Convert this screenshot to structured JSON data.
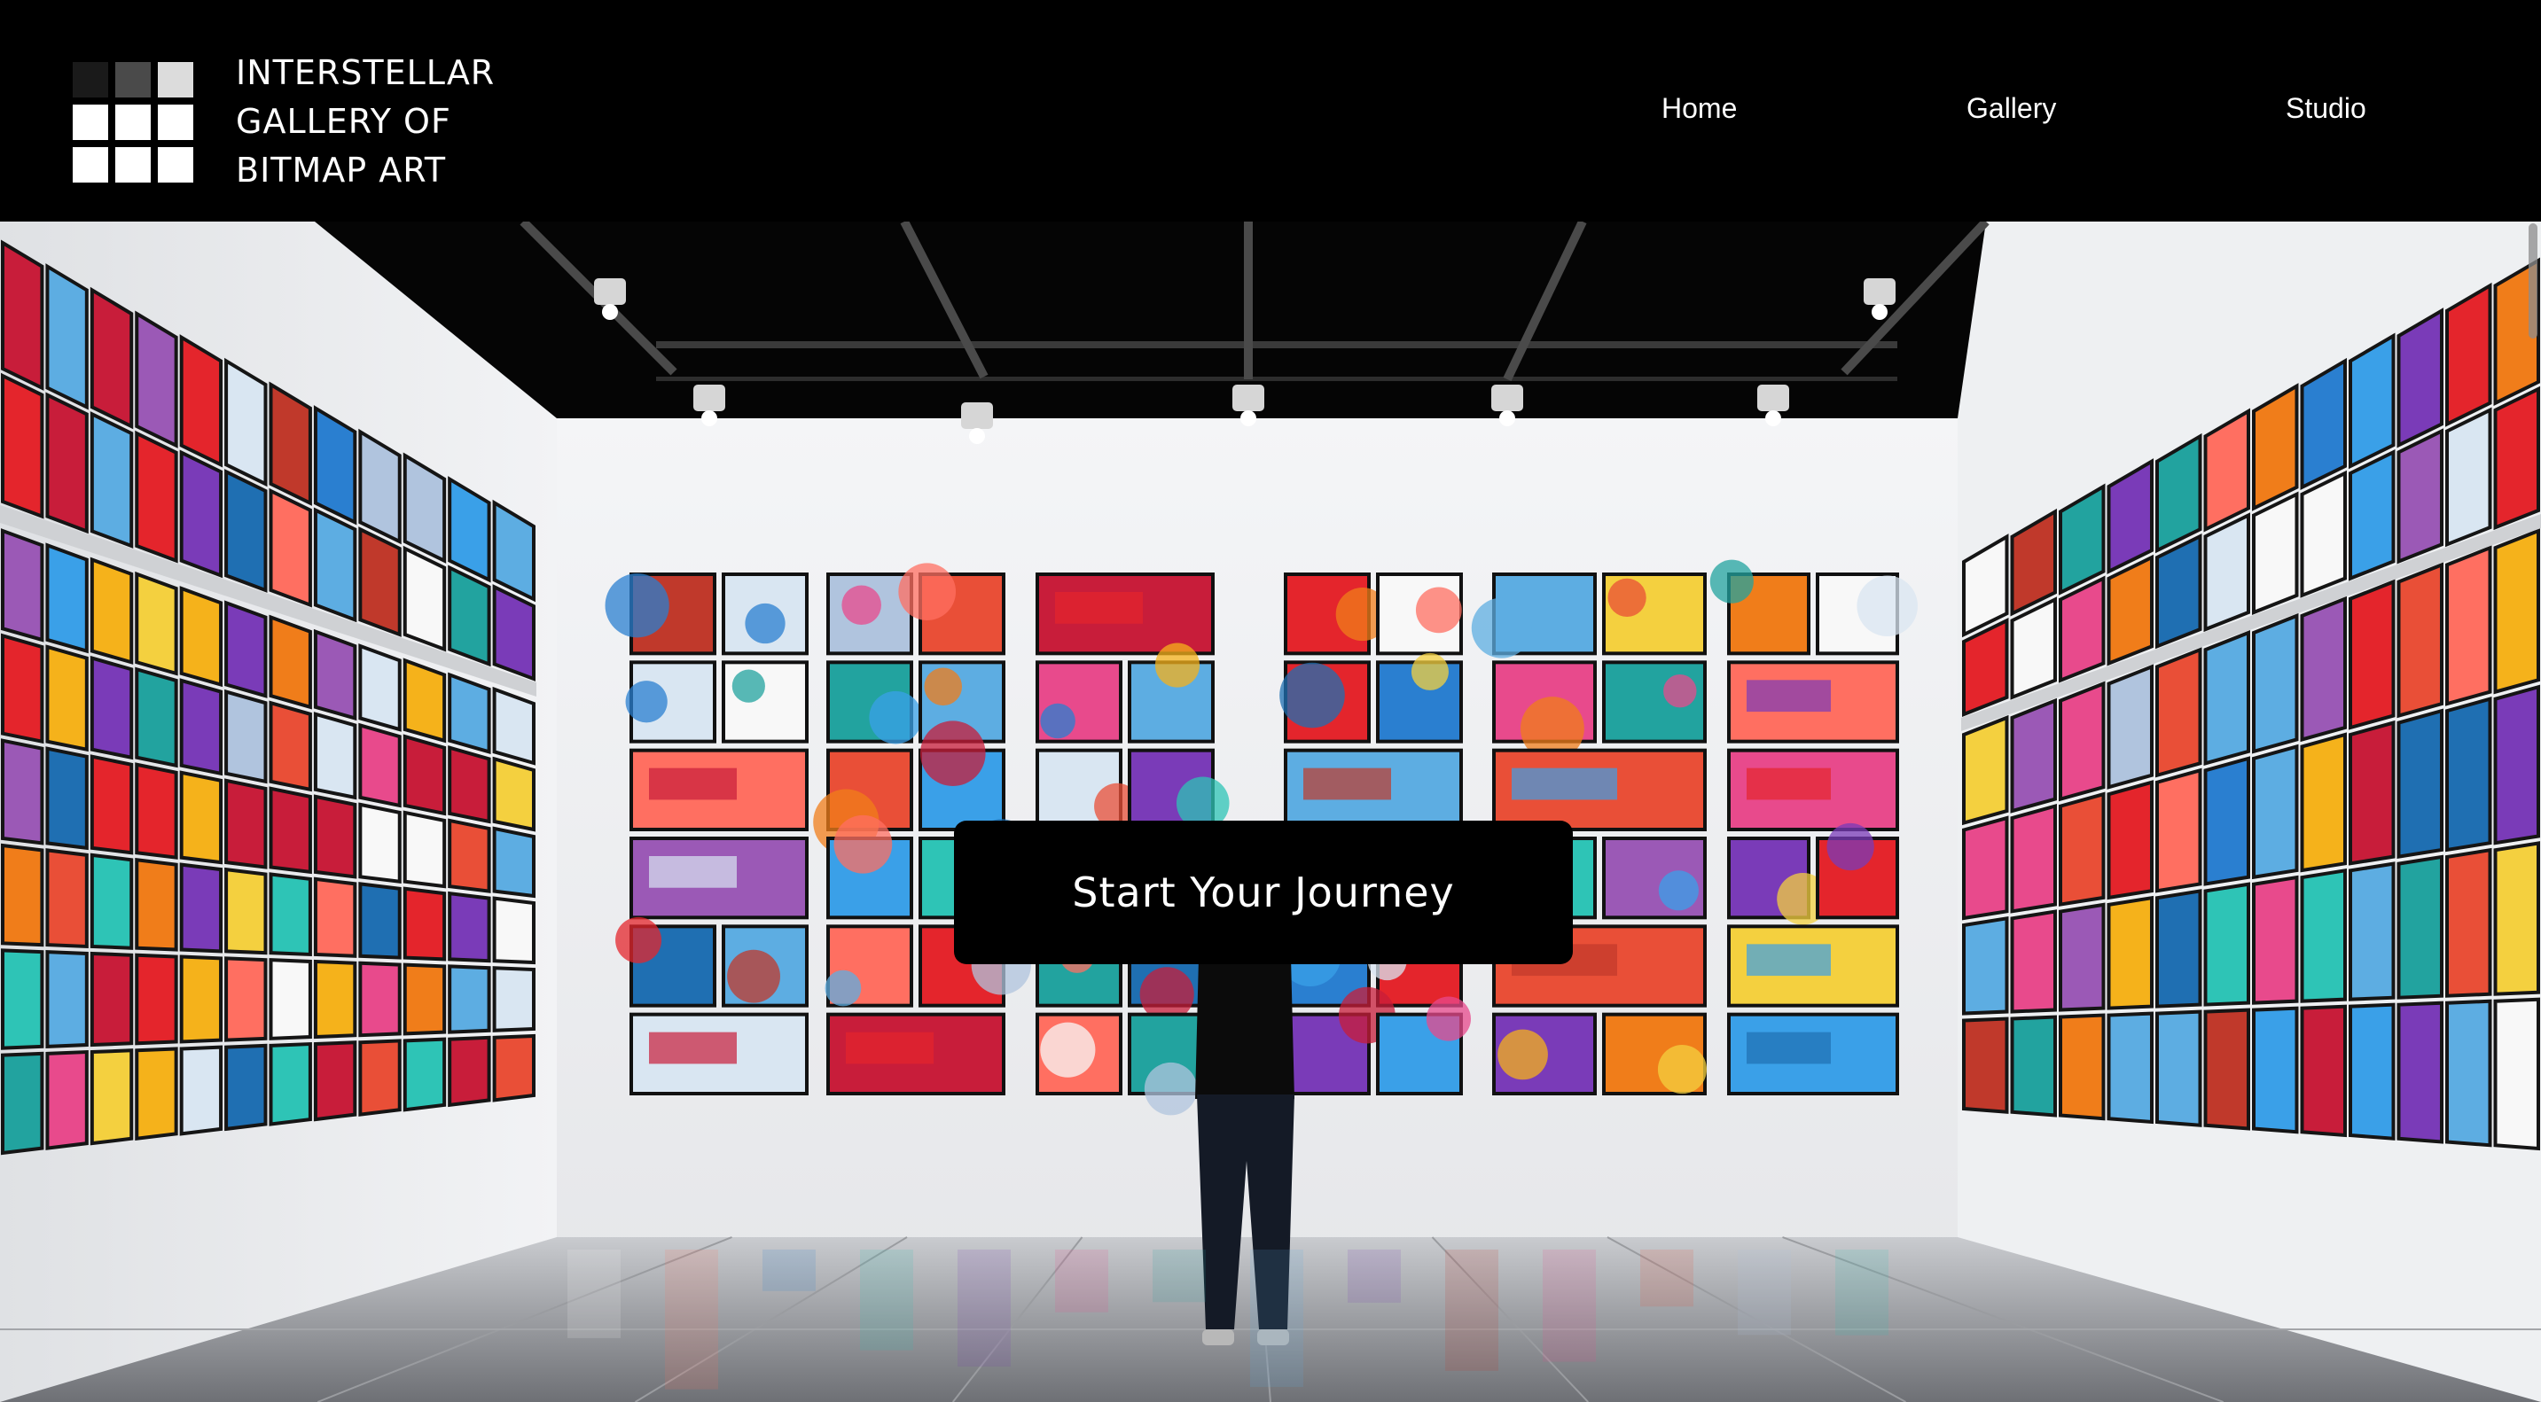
{
  "brand": {
    "lines": [
      "INTERSTELLAR",
      "GALLERY OF",
      "BITMAP ART"
    ],
    "logo_cells": [
      "#1a1a1a",
      "#4a4a4a",
      "#dcdcdc",
      "#ffffff",
      "#ffffff",
      "#ffffff",
      "#ffffff",
      "#ffffff",
      "#ffffff"
    ]
  },
  "nav": {
    "items": [
      {
        "label": "Home"
      },
      {
        "label": "Gallery"
      },
      {
        "label": "Studio"
      }
    ]
  },
  "hero": {
    "cta_label": "Start Your Journey"
  },
  "colors": {
    "header_bg": "#000000",
    "cta_bg": "#000000",
    "text": "#ffffff"
  }
}
